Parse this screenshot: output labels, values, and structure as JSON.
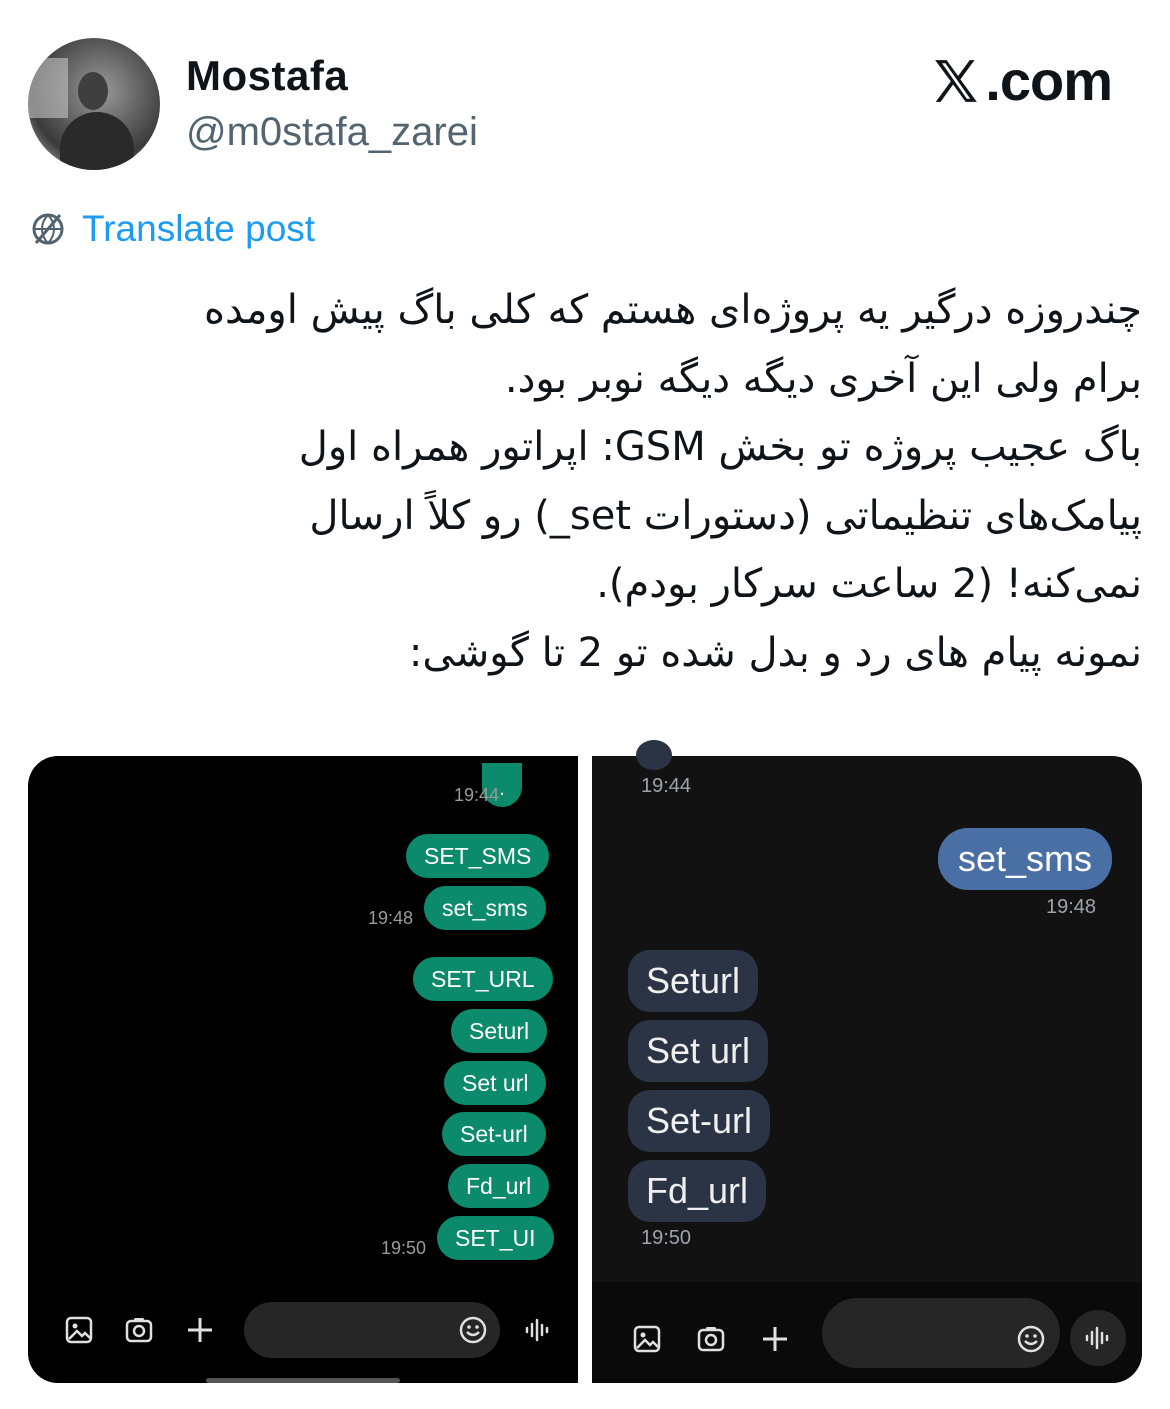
{
  "author": {
    "name": "Mostafa",
    "handle": "@m0stafa_zarei"
  },
  "site": {
    "label": ".com",
    "icon": "x-logo-icon"
  },
  "translate": {
    "label": "Translate post",
    "icon": "translate-globe-icon"
  },
  "tweet": {
    "lines": [
      "چندروزه درگیر یه پروژه‌ای هستم که کلی باگ پیش اومده",
      "برام ولی این آخری دیگه دیگه نوبر بود.",
      "باگ عجیب پروژه تو بخش GSM: اپراتور همراه اول",
      "پیامک‌های تنظیماتی (دستورات set_) رو کلاً ارسال",
      "نمی‌کنه! (2 ساعت سرکار بودم).",
      "نمونه پیام های رد و بدل شده تو 2 تا گوشی:"
    ]
  },
  "left_chat": {
    "top_bubble": ".",
    "time_1944": "19:44",
    "messages": [
      "SET_SMS",
      "set_sms",
      "SET_URL",
      "Seturl",
      "Set url",
      "Set-url",
      "Fd_url",
      "SET_UI"
    ],
    "time_1948": "19:48",
    "time_1950": "19:50",
    "toolbar_icons": [
      "gallery-icon",
      "camera-icon",
      "plus-icon",
      "emoji-icon",
      "voice-icon"
    ]
  },
  "right_chat": {
    "time_1944": "19:44",
    "sent": "set_sms",
    "time_1948": "19:48",
    "received": [
      "Seturl",
      "Set url",
      "Set-url",
      "Fd_url"
    ],
    "time_1950": "19:50",
    "toolbar_icons": [
      "gallery-icon",
      "camera-icon",
      "plus-icon",
      "emoji-icon",
      "voice-icon"
    ]
  },
  "colors": {
    "link": "#1d9bf0",
    "left_bubble": "#0b8a6c",
    "right_sent": "#4a6fa5",
    "right_received": "#2b3444"
  }
}
